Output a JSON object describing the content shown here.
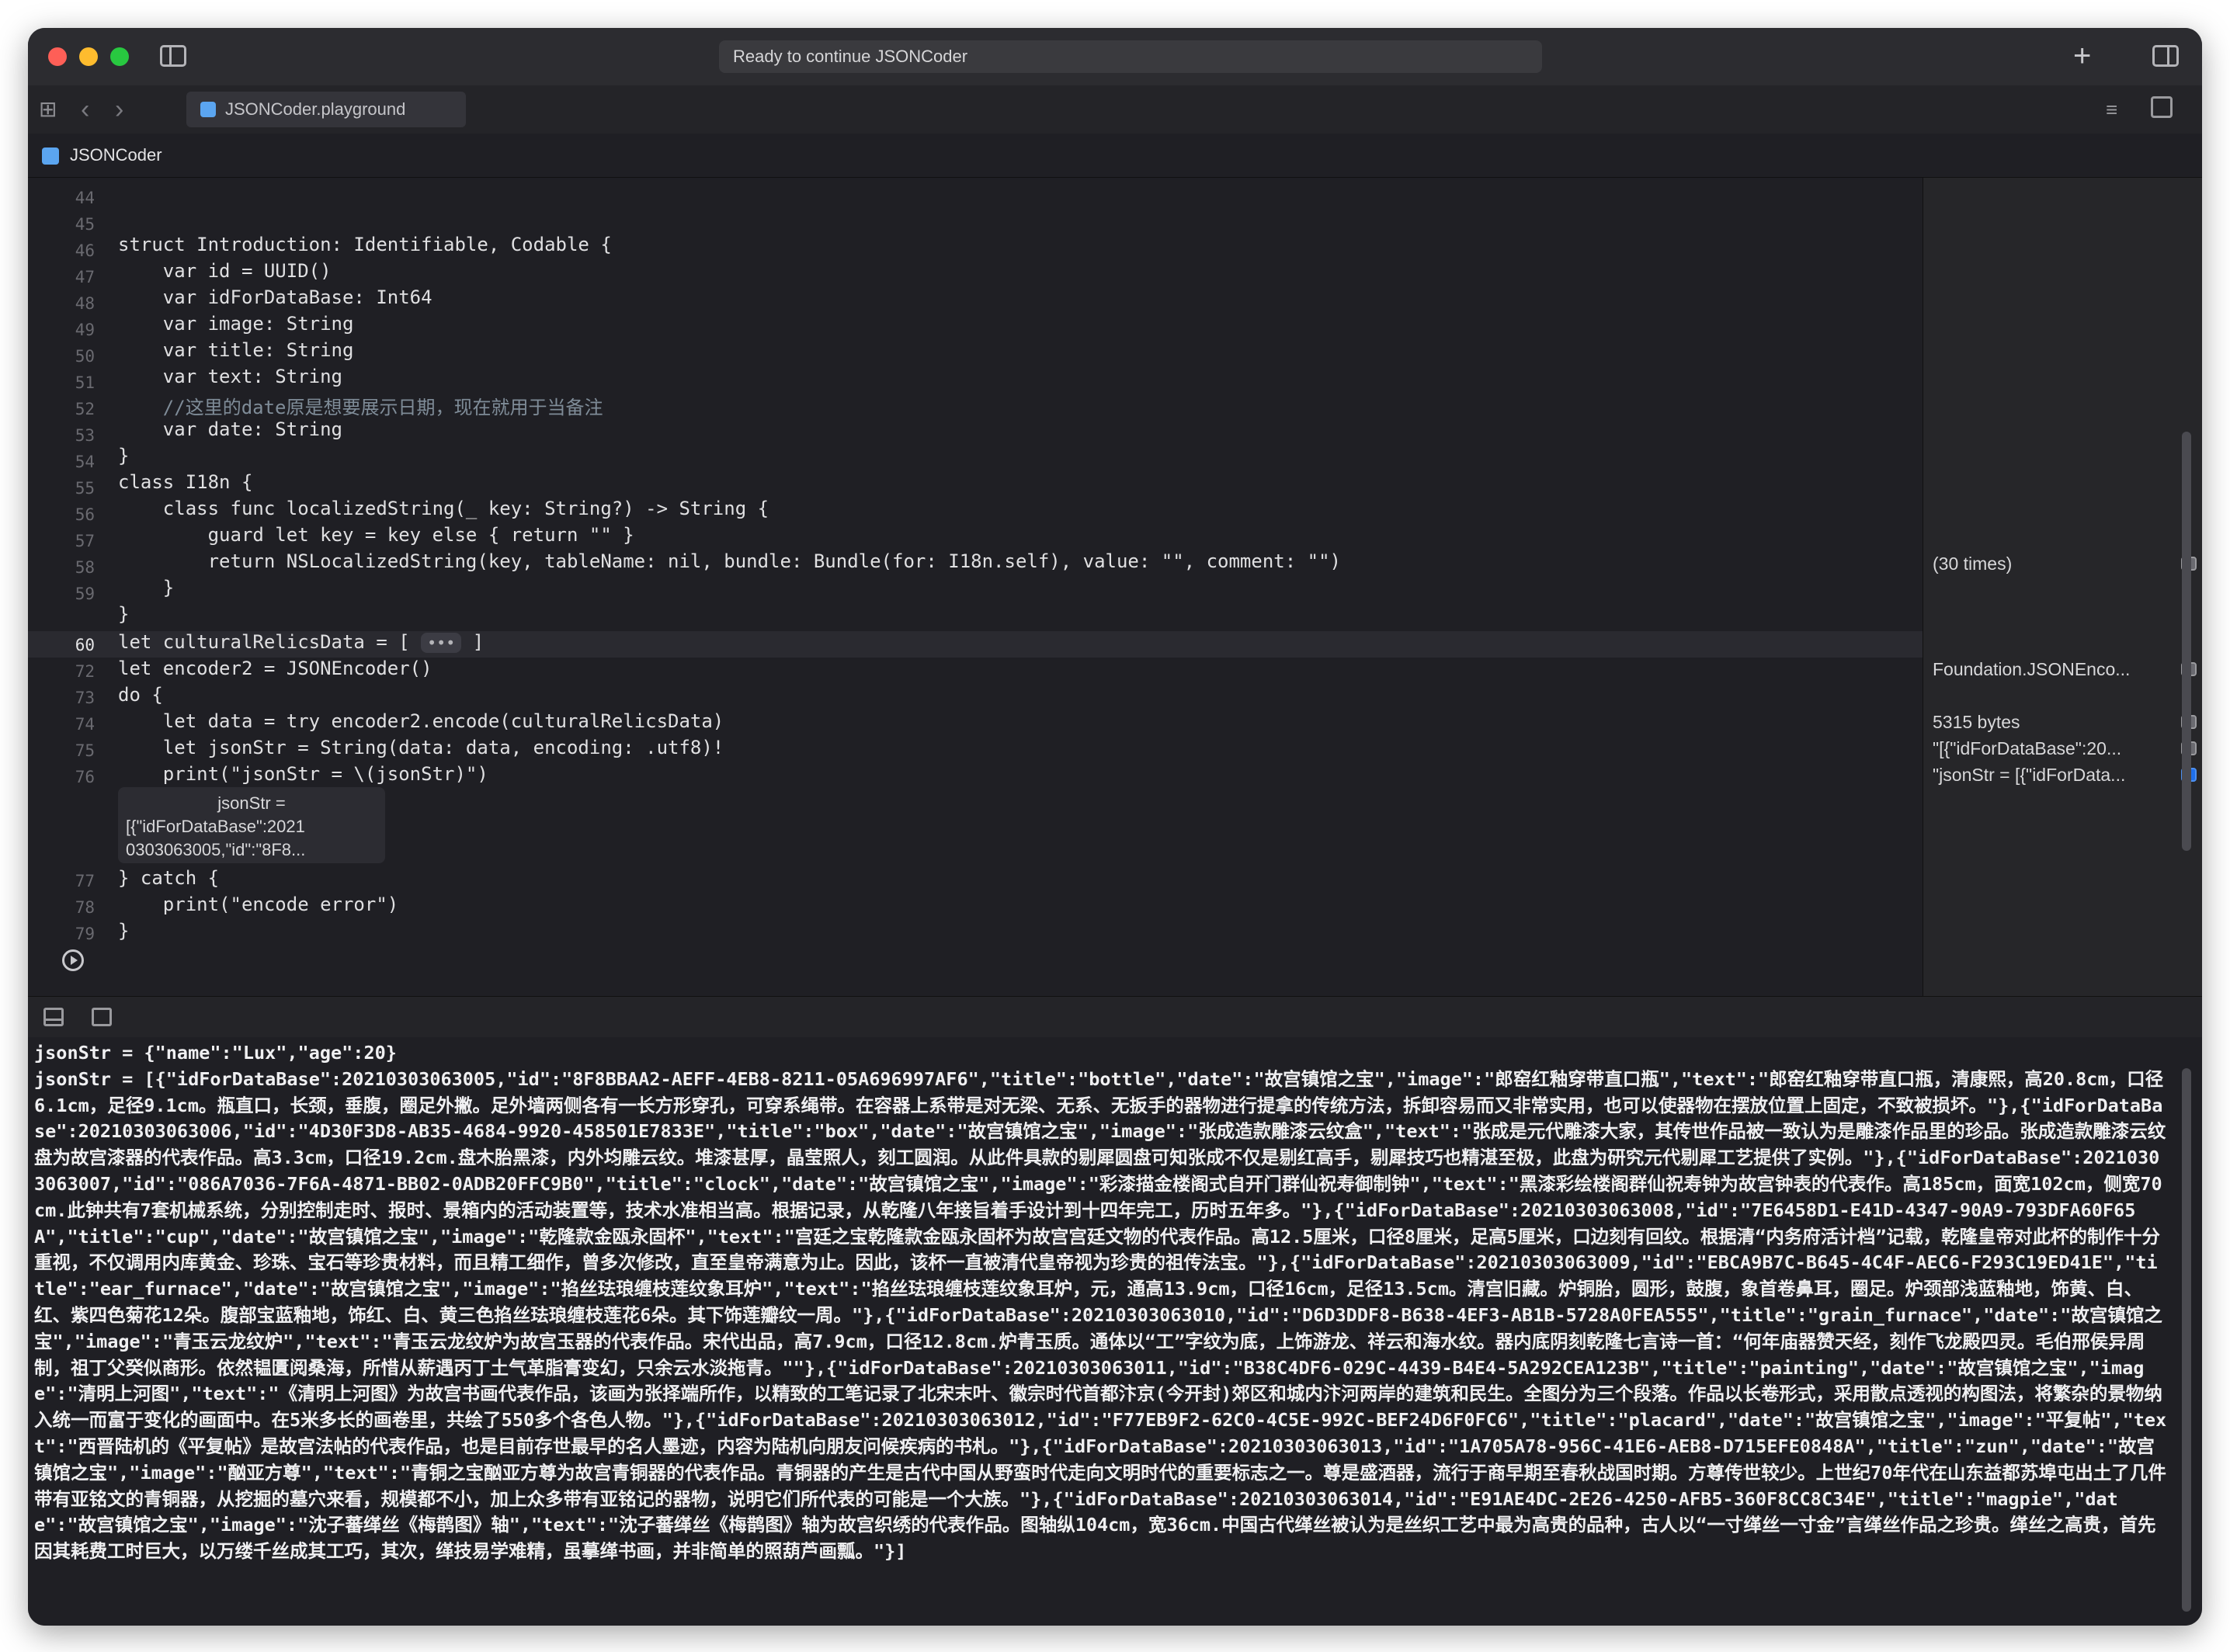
{
  "window": {
    "activity_text": "Ready to continue JSONCoder",
    "tab_label": "JSONCoder.playground",
    "jump_label": "JSONCoder"
  },
  "icons": {
    "close": "close-icon",
    "minimize": "minimize-icon",
    "maximize": "maximize-icon",
    "sidebar": "sidebar-toggle-icon",
    "add": "plus-icon",
    "inspector": "inspector-toggle-icon",
    "grid": "grid-icon",
    "back": "chevron-left-icon",
    "forward": "chevron-right-icon",
    "run": "play-icon"
  },
  "icon_glyphs": {
    "add": "+",
    "grid": "⊞",
    "back": "‹",
    "forward": "›",
    "editor_options": "≡",
    "fold": "•••"
  },
  "gutter": [
    "44",
    "45",
    "46",
    "47",
    "48",
    "49",
    "50",
    "51",
    "52",
    "53",
    "54",
    "55",
    "56",
    "57",
    "58",
    "59",
    "60",
    "72",
    "73",
    "74",
    "75",
    "76",
    "77",
    "78",
    "79"
  ],
  "code": {
    "l44": "",
    "l45": "struct Introduction: Identifiable, Codable {",
    "l46": "    var id = UUID()",
    "l47": "    var idForDataBase: Int64",
    "l48": "    var image: String",
    "l49": "    var title: String",
    "l50": "    var text: String",
    "l51": "    //这里的date原是想要展示日期，现在就用于当备注",
    "l52": "    var date: String",
    "l53": "}",
    "l54": "class I18n {",
    "l55": "    class func localizedString(_ key: String?) -> String {",
    "l56": "        guard let key = key else { return \"\" }",
    "l57": "        return NSLocalizedString(key, tableName: nil, bundle: Bundle(for: I18n.self), value: \"\", comment: \"\")",
    "l58": "    }",
    "l59": "}",
    "l60": "let culturalRelicsData = [",
    "l60_end": "]",
    "l72": "let encoder2 = JSONEncoder()",
    "l73": "do {",
    "l74": "    let data = try encoder2.encode(culturalRelicsData)",
    "l75": "    let jsonStr = String(data: data, encoding: .utf8)!",
    "l76": "    print(\"jsonStr = \\(jsonStr)\")",
    "l77": "} catch {",
    "l78": "    print(\"encode error\")",
    "l79": "}"
  },
  "inline_result": {
    "line1": "jsonStr =",
    "line2": "[{\"idForDataBase\":2021",
    "line3": "0303063005,\"id\":\"8F8..."
  },
  "results": {
    "r57": "(30 times)",
    "r72": "Foundation.JSONEnco...",
    "r74": "5315 bytes",
    "r75": "\"[{\"idForDataBase\":20...",
    "r76": "\"jsonStr = [{\"idForData..."
  },
  "console": {
    "line1": "jsonStr = {\"name\":\"Lux\",\"age\":20}",
    "line2": "jsonStr = [{\"idForDataBase\":20210303063005,\"id\":\"8F8BBAA2-AEFF-4EB8-8211-05A696997AF6\",\"title\":\"bottle\",\"date\":\"故宫镇馆之宝\",\"image\":\"郎窑红釉穿带直口瓶\",\"text\":\"郎窑红釉穿带直口瓶，清康熙，高20.8cm，口径6.1cm，足径9.1cm。瓶直口，长颈，垂腹，圈足外撇。足外墙两侧各有一长方形穿孔，可穿系绳带。在容器上系带是对无梁、无系、无扳手的器物进行提拿的传统方法，拆卸容易而又非常实用，也可以使器物在摆放位置上固定，不致被损坏。\"},{\"idForDataBase\":20210303063006,\"id\":\"4D30F3D8-AB35-4684-9920-458501E7833E\",\"title\":\"box\",\"date\":\"故宫镇馆之宝\",\"image\":\"张成造款雕漆云纹盒\",\"text\":\"张成是元代雕漆大家，其传世作品被一致认为是雕漆作品里的珍品。张成造款雕漆云纹盘为故宫漆器的代表作品。高3.3cm，口径19.2cm.盘木胎黑漆，内外均雕云纹。堆漆甚厚，晶莹照人，刻工圆润。从此件具款的剔犀圆盘可知张成不仅是剔红高手，剔犀技巧也精湛至极，此盘为研究元代剔犀工艺提供了实例。\"},{\"idForDataBase\":20210303063007,\"id\":\"086A7036-7F6A-4871-BB02-0ADB20FFC9B0\",\"title\":\"clock\",\"date\":\"故宫镇馆之宝\",\"image\":\"彩漆描金楼阁式自开门群仙祝寿御制钟\",\"text\":\"黑漆彩绘楼阁群仙祝寿钟为故宫钟表的代表作。高185cm，面宽102cm，侧宽70cm.此钟共有7套机械系统，分别控制走时、报时、景箱内的活动装置等，技术水准相当高。根据记录，从乾隆八年接旨着手设计到十四年完工，历时五年多。\"},{\"idForDataBase\":20210303063008,\"id\":\"7E6458D1-E41D-4347-90A9-793DFA60F65A\",\"title\":\"cup\",\"date\":\"故宫镇馆之宝\",\"image\":\"乾隆款金瓯永固杯\",\"text\":\"宫廷之宝乾隆款金瓯永固杯为故宫宫廷文物的代表作品。高12.5厘米，口径8厘米，足高5厘米，口边刻有回纹。根据清“内务府活计档”记载，乾隆皇帝对此杯的制作十分重视，不仅调用内库黄金、珍珠、宝石等珍贵材料，而且精工细作，曾多次修改，直至皇帝满意为止。因此，该杯一直被清代皇帝视为珍贵的祖传法宝。\"},{\"idForDataBase\":20210303063009,\"id\":\"EBCA9B7C-B645-4C4F-AEC6-F293C19ED41E\",\"title\":\"ear_furnace\",\"date\":\"故宫镇馆之宝\",\"image\":\"掐丝珐琅缠枝莲纹象耳炉\",\"text\":\"掐丝珐琅缠枝莲纹象耳炉，元，通高13.9cm，口径16cm，足径13.5cm。清宫旧藏。炉铜胎，圆形，鼓腹，象首卷鼻耳，圈足。炉颈部浅蓝釉地，饰黄、白、红、紫四色菊花12朵。腹部宝蓝釉地，饰红、白、黄三色掐丝珐琅缠枝莲花6朵。其下饰莲瓣纹一周。\"},{\"idForDataBase\":20210303063010,\"id\":\"D6D3DDF8-B638-4EF3-AB1B-5728A0FEA555\",\"title\":\"grain_furnace\",\"date\":\"故宫镇馆之宝\",\"image\":\"青玉云龙纹炉\",\"text\":\"青玉云龙纹炉为故宫玉器的代表作品。宋代出品，高7.9cm，口径12.8cm.炉青玉质。通体以“工”字纹为底，上饰游龙、祥云和海水纹。器内底阴刻乾隆七言诗一首：“何年庙器赞天经，刻作飞龙殿四灵。毛伯邢侯异周制，祖丁父癸似商形。依然韫匱阅桑海，所惜从薪遇丙丁土气革脂膏变幻，只余云水淡拖青。\"\"},{\"idForDataBase\":20210303063011,\"id\":\"B38C4DF6-029C-4439-B4E4-5A292CEA123B\",\"title\":\"painting\",\"date\":\"故宫镇馆之宝\",\"image\":\"清明上河图\",\"text\":\"《清明上河图》为故宫书画代表作品，该画为张择端所作，以精致的工笔记录了北宋末叶、徽宗时代首都汴京(今开封)郊区和城内汴河两岸的建筑和民生。全图分为三个段落。作品以长卷形式，采用散点透视的构图法，将繁杂的景物纳入统一而富于变化的画面中。在5米多长的画卷里，共绘了550多个各色人物。\"},{\"idForDataBase\":20210303063012,\"id\":\"F77EB9F2-62C0-4C5E-992C-BEF24D6F0FC6\",\"title\":\"placard\",\"date\":\"故宫镇馆之宝\",\"image\":\"平复帖\",\"text\":\"西晋陆机的《平复帖》是故宫法帖的代表作品，也是目前存世最早的名人墨迹，内容为陆机向朋友问候疾病的书札。\"},{\"idForDataBase\":20210303063013,\"id\":\"1A705A78-956C-41E6-AEB8-D715EFE0848A\",\"title\":\"zun\",\"date\":\"故宫镇馆之宝\",\"image\":\"酗亚方尊\",\"text\":\"青铜之宝酗亚方尊为故宫青铜器的代表作品。青铜器的产生是古代中国从野蛮时代走向文明时代的重要标志之一。尊是盛酒器，流行于商早期至春秋战国时期。方尊传世较少。上世纪70年代在山东益都苏埠屯出土了几件带有亚铭文的青铜器，从挖掘的墓穴来看，规模都不小，加上众多带有亚铭记的器物，说明它们所代表的可能是一个大族。\"},{\"idForDataBase\":20210303063014,\"id\":\"E91AE4DC-2E26-4250-AFB5-360F8CC8C34E\",\"title\":\"magpie\",\"date\":\"故宫镇馆之宝\",\"image\":\"沈子蕃缂丝《梅鹊图》轴\",\"text\":\"沈子蕃缂丝《梅鹊图》轴为故宫织绣的代表作品。图轴纵104cm，宽36cm.中国古代缂丝被认为是丝织工艺中最为高贵的品种，古人以“一寸缂丝一寸金”言缂丝作品之珍贵。缂丝之高贵，首先因其耗费工时巨大，以万缕千丝成其工巧，其次，缂技易学难精，虽摹缂书画，并非简单的照葫芦画瓢。\"}]"
  }
}
